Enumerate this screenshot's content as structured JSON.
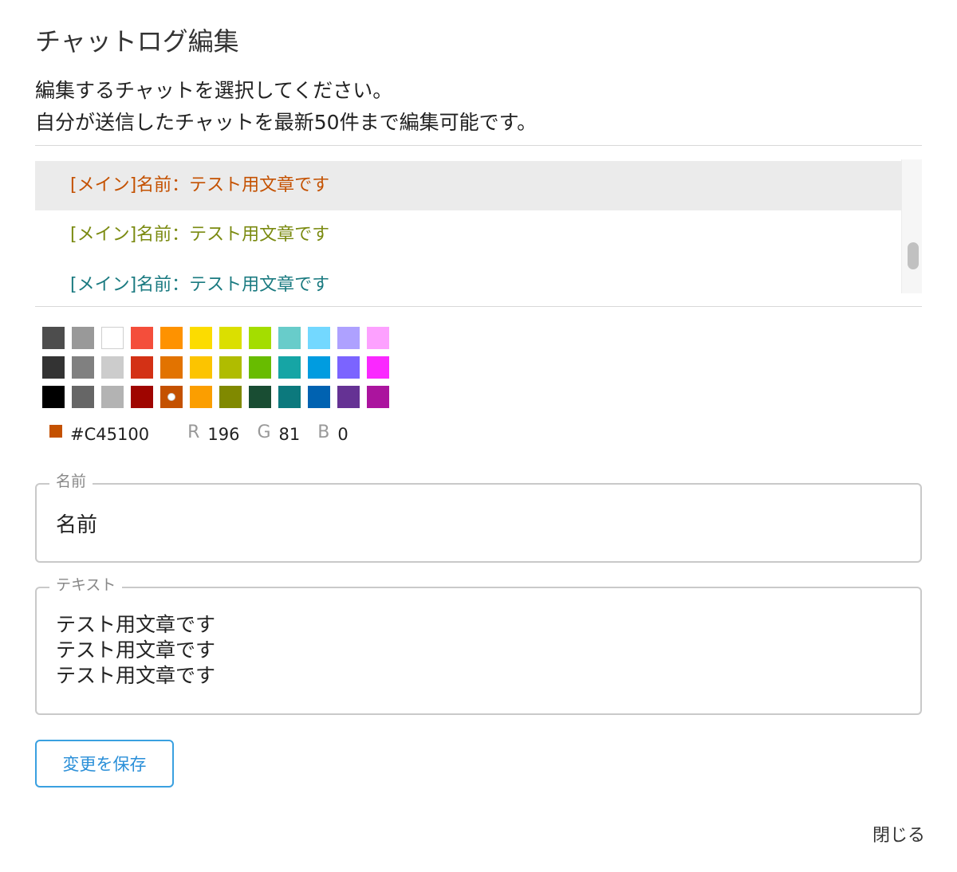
{
  "dialog": {
    "title": "チャットログ編集",
    "description_line1": "編集するチャットを選択してください。",
    "description_line2": "自分が送信したチャットを最新50件まで編集可能です。"
  },
  "chat_list": {
    "items": [
      {
        "text": "[メイン]名前：テスト用文章です",
        "color": "#C45100",
        "selected": true
      },
      {
        "text": "[メイン]名前：テスト用文章です",
        "color": "#7A8A10",
        "selected": false
      },
      {
        "text": "[メイン]名前：テスト用文章です",
        "color": "#1A7A80",
        "selected": false
      }
    ]
  },
  "color_picker": {
    "swatches": [
      [
        "#4D4D4D",
        "#999999",
        "#FFFFFF",
        "#F44E3B",
        "#FE9200",
        "#FCDC00",
        "#DBDF00",
        "#A4DD00",
        "#68CCCA",
        "#73D8FF",
        "#AEA1FF",
        "#FDA1FF"
      ],
      [
        "#333333",
        "#808080",
        "#CCCCCC",
        "#D33115",
        "#E27300",
        "#FCC400",
        "#B0BC00",
        "#68BC00",
        "#16A5A5",
        "#009CE0",
        "#7B64FF",
        "#FA28FF"
      ],
      [
        "#000000",
        "#666666",
        "#B3B3B3",
        "#9F0500",
        "#C45100",
        "#FB9E00",
        "#808900",
        "#194D33",
        "#0C797D",
        "#0062B1",
        "#653294",
        "#AB149E"
      ]
    ],
    "selected_color": "#C45100",
    "hex_label": "#C45100",
    "r_label": "R",
    "r_value": "196",
    "g_label": "G",
    "g_value": "81",
    "b_label": "B",
    "b_value": "0"
  },
  "name_field": {
    "label": "名前",
    "value": "名前"
  },
  "text_field": {
    "label": "テキスト",
    "value": "テスト用文章です\nテスト用文章です\nテスト用文章です"
  },
  "buttons": {
    "save_label": "変更を保存",
    "close_label": "閉じる"
  },
  "colors": {
    "accent": "#2A8FD8",
    "selected_row_bg": "#EBEBEB"
  }
}
